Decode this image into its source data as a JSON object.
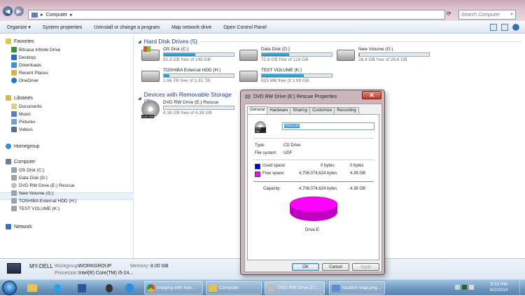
{
  "window": {
    "address": "Computer",
    "search_placeholder": "Search Computer"
  },
  "toolbar": {
    "items": [
      "Organize ▾",
      "System properties",
      "Uninstall or change a program",
      "Map network drive",
      "Open Control Panel"
    ]
  },
  "sidebar": {
    "favorites": "Favorites",
    "favorites_items": [
      "Bitcasa Infinite Drive",
      "Desktop",
      "Downloads",
      "Recent Places",
      "OneDrive"
    ],
    "libraries": "Libraries",
    "libraries_items": [
      "Documents",
      "Music",
      "Pictures",
      "Videos"
    ],
    "homegroup": "Homegroup",
    "computer": "Computer",
    "computer_items": [
      "OS Disk (C:)",
      "Data Disk (D:)",
      "DVD RW Drive (E:) Rescue",
      "New Volume (G:)",
      "TOSHIBA External HDD (H:)",
      "TEST VOLUME (K:)"
    ],
    "network": "Network"
  },
  "main": {
    "hdd_header": "Hard Disk Drives (5)",
    "removable_header": "Devices with Removable Storage (2)",
    "drives": [
      {
        "name": "OS Disk (C:)",
        "free": "81.8 GB free of 149 GB",
        "used_fraction": 0.45
      },
      {
        "name": "Data Disk (D:)",
        "free": "72.8 GB free of 119 GB",
        "used_fraction": 0.39
      },
      {
        "name": "New Volume (G:)",
        "free": "26.4 GB free of 26.6 GB",
        "used_fraction": 0.01
      },
      {
        "name": "TOSHIBA External HDD (H:)",
        "free": "1.66 TB free of 1.81 TB",
        "used_fraction": 0.08
      },
      {
        "name": "TEST VOLUME (K:)",
        "free": "815 MB free of 1.99 GB",
        "used_fraction": 0.6
      }
    ],
    "removable": [
      {
        "name": "DVD RW Drive (E:) Rescue",
        "free": "4.38 GB free of 4.38 GB",
        "icon_label": "DVD-RW",
        "used_fraction": 0.0
      }
    ]
  },
  "status": {
    "name": "MY-DELL",
    "workgroup_label": "Workgroup:",
    "workgroup": "WORKGROUP",
    "memory_label": "Memory:",
    "memory": "8.00 GB",
    "processor_label": "Processor:",
    "processor": "Intel(R) Core(TM) i5-24..."
  },
  "dialog": {
    "title": "DVD RW Drive (E:) Rescue Properties",
    "close": "✕",
    "tabs": [
      "General",
      "Hardware",
      "Sharing",
      "Customize",
      "Recording"
    ],
    "icon_label": "DVD-RW",
    "name_value": "Rescue",
    "type_label": "Type:",
    "type_value": "CD Drive",
    "fs_label": "File system:",
    "fs_value": "UDF",
    "used_label": "Used space:",
    "used_bytes": "0 bytes",
    "used_h": "0 bytes",
    "free_label": "Free space:",
    "free_bytes": "4,706,074,624 bytes",
    "free_h": "4.38 GB",
    "capacity_label": "Capacity:",
    "capacity_bytes": "4,706,074,624 bytes",
    "capacity_h": "4.38 GB",
    "drive_label": "Drive E:",
    "ok": "OK",
    "cancel": "Cancel",
    "apply": "Apply",
    "used_color": "#0000ff",
    "free_color": "#ff00ff"
  },
  "taskbar": {
    "windows": [
      {
        "label": "Imaging with free..."
      },
      {
        "label": "Computer"
      },
      {
        "label": "DVD RW Drive (E:)..."
      },
      {
        "label": "location map.png..."
      }
    ],
    "time": "9:53 PM",
    "date": "6/2/2014"
  }
}
